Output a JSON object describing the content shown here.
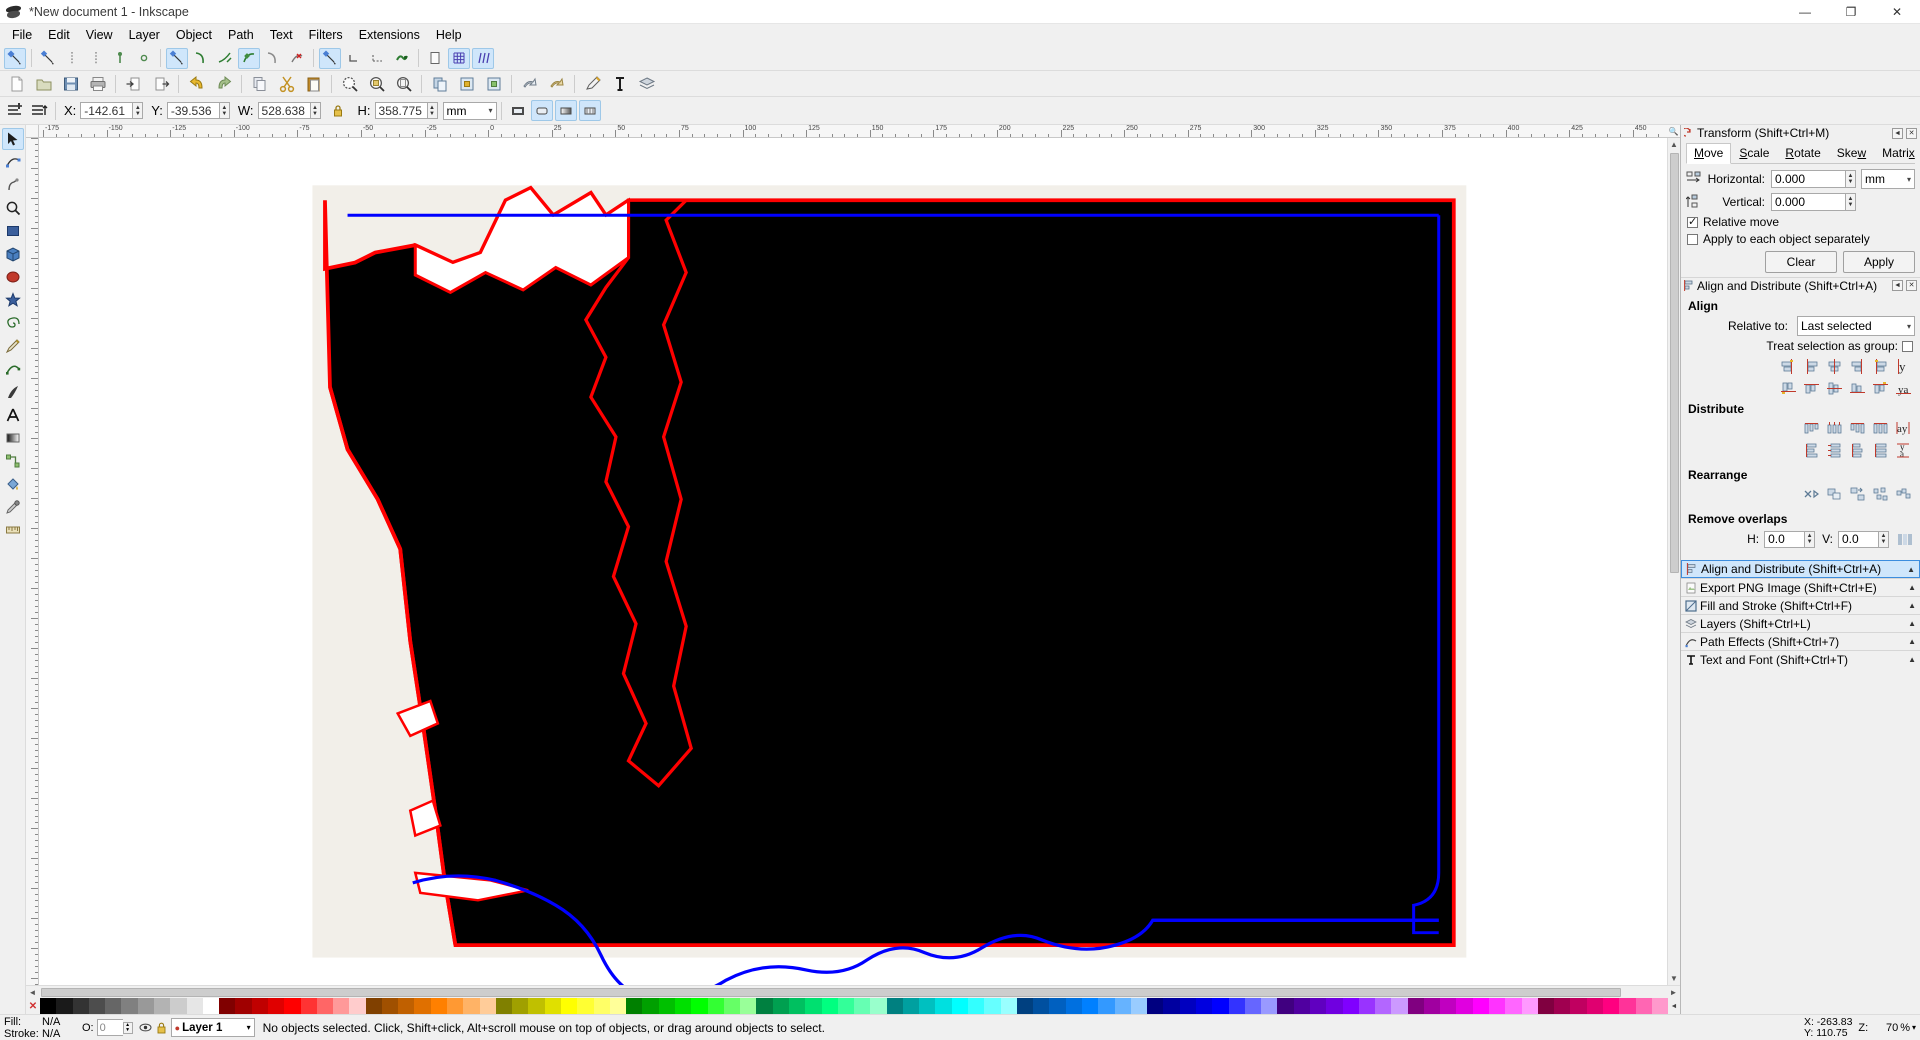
{
  "window": {
    "title": "*New document 1 - Inkscape",
    "app_icon": "inkscape-logo-icon",
    "buttons": [
      {
        "name": "minimize-button",
        "glyph": "—"
      },
      {
        "name": "maximize-button",
        "glyph": "❐"
      },
      {
        "name": "close-button",
        "glyph": "✕"
      }
    ]
  },
  "menubar": {
    "items": [
      {
        "label": "File"
      },
      {
        "label": "Edit"
      },
      {
        "label": "View"
      },
      {
        "label": "Layer"
      },
      {
        "label": "Object"
      },
      {
        "label": "Path"
      },
      {
        "label": "Text"
      },
      {
        "label": "Filters"
      },
      {
        "label": "Extensions"
      },
      {
        "label": "Help"
      }
    ]
  },
  "snap_toolbar": {
    "buttons": [
      {
        "name": "snap-enable-button",
        "icon": "snap-node-cusp-icon",
        "active": true
      },
      {
        "name": "snap-bounding-box-button",
        "icon": "snap-bbox-icon",
        "active": false
      },
      {
        "name": "snap-bbox-edge-button",
        "icon": "snap-bbox-edge-icon",
        "active": false
      },
      {
        "name": "snap-bbox-corner-button",
        "icon": "snap-bbox-corner-icon",
        "active": false
      },
      {
        "name": "snap-bbox-edge-midpoint-button",
        "icon": "snap-bbox-edge-mid-icon",
        "active": false
      },
      {
        "name": "snap-bbox-center-button",
        "icon": "snap-bbox-center-icon",
        "active": false
      },
      {
        "name": "snap-nodes-button",
        "icon": "snap-nodes-icon",
        "active": true
      },
      {
        "name": "snap-path-button",
        "icon": "snap-path-icon",
        "active": false
      },
      {
        "name": "snap-path-intersection-button",
        "icon": "snap-path-intersection-icon",
        "active": false
      },
      {
        "name": "snap-to-cusp-node-button",
        "icon": "snap-cusp-node-icon",
        "active": true
      },
      {
        "name": "snap-smooth-node-button",
        "icon": "snap-smooth-node-icon",
        "active": false
      },
      {
        "name": "snap-midpoint-button",
        "icon": "snap-midpoint-icon",
        "active": false
      },
      {
        "name": "snap-others-button",
        "icon": "snap-others-icon",
        "active": true
      },
      {
        "name": "snap-object-center-button",
        "icon": "snap-object-center-icon",
        "active": false
      },
      {
        "name": "snap-rotation-center-button",
        "icon": "snap-rotation-center-icon",
        "active": false
      },
      {
        "name": "snap-text-baseline-button",
        "icon": "snap-text-baseline-icon",
        "active": false
      },
      {
        "name": "snap-page-border-button",
        "icon": "snap-page-border-icon",
        "active": false
      },
      {
        "name": "snap-grid-button",
        "icon": "snap-grid-icon",
        "active": true
      },
      {
        "name": "snap-guide-button",
        "icon": "snap-guide-icon",
        "active": true
      }
    ]
  },
  "command_toolbar": {
    "buttons": [
      {
        "name": "new-document-button",
        "icon": "new-document-icon"
      },
      {
        "name": "open-document-button",
        "icon": "open-folder-icon"
      },
      {
        "name": "save-document-button",
        "icon": "floppy-save-icon"
      },
      {
        "name": "print-document-button",
        "icon": "printer-icon"
      },
      {
        "name": "import-button",
        "icon": "import-arrow-icon"
      },
      {
        "name": "export-button",
        "icon": "export-arrow-icon"
      },
      {
        "name": "undo-button",
        "icon": "undo-arrow-icon"
      },
      {
        "name": "redo-button",
        "icon": "redo-arrow-icon"
      },
      {
        "name": "copy-button",
        "icon": "copy-icon"
      },
      {
        "name": "cut-button",
        "icon": "scissors-icon"
      },
      {
        "name": "paste-button",
        "icon": "clipboard-paste-icon"
      },
      {
        "name": "zoom-selection-button",
        "icon": "zoom-selection-icon"
      },
      {
        "name": "zoom-drawing-button",
        "icon": "zoom-drawing-icon"
      },
      {
        "name": "zoom-page-button",
        "icon": "zoom-page-icon"
      },
      {
        "name": "duplicate-button",
        "icon": "duplicate-icon"
      },
      {
        "name": "group-button",
        "icon": "group-lock-icon"
      },
      {
        "name": "ungroup-button",
        "icon": "ungroup-icon"
      },
      {
        "name": "raise-to-top-button",
        "icon": "raise-object-icon"
      },
      {
        "name": "lower-to-bottom-button",
        "icon": "lower-object-icon"
      },
      {
        "name": "xml-editor-button",
        "icon": "pencil-xml-icon"
      },
      {
        "name": "text-and-font-button",
        "icon": "text-tool-icon"
      },
      {
        "name": "layers-dialog-button",
        "icon": "layers-stack-icon"
      },
      {
        "name": "fill-stroke-button",
        "icon": "fill-stroke-icon"
      },
      {
        "name": "preferences-button",
        "icon": "gear-icon"
      }
    ]
  },
  "tool_options": {
    "buttons": [
      {
        "name": "select-all-button",
        "icon": "select-all-icon"
      },
      {
        "name": "select-all-layers-button",
        "icon": "select-all-layers-icon"
      },
      {
        "name": "deselect-button",
        "icon": "deselect-icon"
      },
      {
        "name": "rotate-ccw-button",
        "icon": "rotate-ccw-icon"
      },
      {
        "name": "rotate-cw-button",
        "icon": "rotate-cw-icon"
      },
      {
        "name": "flip-horizontal-button",
        "icon": "flip-horizontal-icon"
      },
      {
        "name": "flip-vertical-button",
        "icon": "flip-vertical-icon"
      },
      {
        "name": "raise-top-button",
        "icon": "raise-top-icon"
      },
      {
        "name": "raise-one-button",
        "icon": "raise-one-icon"
      },
      {
        "name": "lower-one-button",
        "icon": "lower-one-icon"
      },
      {
        "name": "lower-bottom-button",
        "icon": "lower-bottom-icon"
      }
    ],
    "fields": [
      {
        "name": "x-field",
        "label": "X:",
        "value": "-142.61"
      },
      {
        "name": "y-field",
        "label": "Y:",
        "value": "-39.536"
      },
      {
        "name": "w-field",
        "label": "W:",
        "value": "528.638"
      },
      {
        "name": "h-field",
        "label": "H:",
        "value": "358.775"
      }
    ],
    "lock_icon": "lock-ratio-icon",
    "units": "mm",
    "affect_buttons": [
      {
        "name": "affect-stroke-width-button",
        "icon": "scale-stroke-icon",
        "active": false
      },
      {
        "name": "affect-rounded-corners-button",
        "icon": "scale-corners-icon",
        "active": true
      },
      {
        "name": "affect-gradients-button",
        "icon": "scale-gradients-icon",
        "active": true
      },
      {
        "name": "affect-patterns-button",
        "icon": "scale-patterns-icon",
        "active": true
      }
    ]
  },
  "toolbox": {
    "tools": [
      {
        "name": "tool-selector",
        "icon": "arrow-pointer-icon",
        "active": true
      },
      {
        "name": "tool-node-editor",
        "icon": "node-editor-icon",
        "active": false
      },
      {
        "name": "tool-tweak",
        "icon": "tweak-icon",
        "active": false
      },
      {
        "name": "tool-zoom",
        "icon": "magnifier-icon",
        "active": false
      },
      {
        "name": "tool-rectangle",
        "icon": "rectangle-icon",
        "active": false
      },
      {
        "name": "tool-3dbox",
        "icon": "cube-3d-icon",
        "active": false
      },
      {
        "name": "tool-ellipse",
        "icon": "ellipse-icon",
        "active": false
      },
      {
        "name": "tool-star",
        "icon": "star-icon",
        "active": false
      },
      {
        "name": "tool-spiral",
        "icon": "spiral-icon",
        "active": false
      },
      {
        "name": "tool-pencil",
        "icon": "pencil-icon",
        "active": false
      },
      {
        "name": "tool-bezier",
        "icon": "bezier-pen-icon",
        "active": false
      },
      {
        "name": "tool-calligraphy",
        "icon": "calligraphy-icon",
        "active": false
      },
      {
        "name": "tool-text",
        "icon": "text-a-icon",
        "active": false
      },
      {
        "name": "tool-gradient",
        "icon": "gradient-icon",
        "active": false
      },
      {
        "name": "tool-connector",
        "icon": "connector-icon",
        "active": false
      },
      {
        "name": "tool-paint-bucket",
        "icon": "paint-bucket-icon",
        "active": false
      },
      {
        "name": "tool-dropper",
        "icon": "eyedropper-icon",
        "active": false
      },
      {
        "name": "tool-measure",
        "icon": "measure-ruler-icon",
        "active": false
      }
    ]
  },
  "canvas": {
    "ruler_unit_icon": "zoom-unit-icon",
    "h_ruler_labels": [
      "-175",
      "-150",
      "-125",
      "-100",
      "-75",
      "-50",
      "-25",
      "0",
      "25",
      "50",
      "75",
      "100",
      "125",
      "150",
      "175",
      "200",
      "225",
      "250",
      "275",
      "300",
      "325",
      "350",
      "375",
      "400",
      "425",
      "450"
    ],
    "document": {
      "page_background": "#f2efe9",
      "artwork_fill": "#000000",
      "artwork_stroke": "#ff0000",
      "overlay_path_stroke": "#0000ff",
      "description": "Map outline of Washington State filled black with red coastline stroke and a blue boundary path"
    }
  },
  "transform_panel": {
    "title": "Transform (Shift+Ctrl+M)",
    "title_icon": "transform-dialog-icon",
    "float_button": "float-dialog-icon",
    "close_button": "close-dialog-icon",
    "tabs": [
      {
        "name": "tab-move",
        "label": "Move",
        "mnemonic": "M",
        "active": true
      },
      {
        "name": "tab-scale",
        "label": "Scale",
        "mnemonic": "S",
        "active": false
      },
      {
        "name": "tab-rotate",
        "label": "Rotate",
        "mnemonic": "R",
        "active": false
      },
      {
        "name": "tab-skew",
        "label": "Skew",
        "mnemonic": "w",
        "active": false
      },
      {
        "name": "tab-matrix",
        "label": "Matrix",
        "mnemonic": "x",
        "active": false
      }
    ],
    "horizontal": {
      "label": "Horizontal:",
      "value": "0.000",
      "icon": "move-horizontal-icon"
    },
    "vertical": {
      "label": "Vertical:",
      "value": "0.000",
      "icon": "move-vertical-icon"
    },
    "unit": "mm",
    "relative_move": {
      "label": "Relative move",
      "checked": true
    },
    "apply_each": {
      "label": "Apply to each object separately",
      "checked": false
    },
    "clear_button": "Clear",
    "apply_button": "Apply"
  },
  "align_panel": {
    "title": "Align and Distribute (Shift+Ctrl+A)",
    "title_icon": "align-dialog-icon",
    "float_button": "float-dialog-icon",
    "close_button": "close-dialog-icon",
    "align": {
      "heading": "Align",
      "relative_to_label": "Relative to:",
      "relative_to_value": "Last selected",
      "treat_as_group_label": "Treat selection as group:",
      "treat_as_group_checked": false,
      "row1": [
        {
          "name": "align-right-edge-to-left-anchor-button",
          "icon": "align-right-to-anchor-icon"
        },
        {
          "name": "align-left-edges-button",
          "icon": "align-left-edges-icon"
        },
        {
          "name": "align-horizontal-centers-button",
          "icon": "align-h-centers-icon"
        },
        {
          "name": "align-right-edges-button",
          "icon": "align-right-edges-icon"
        },
        {
          "name": "align-left-edge-to-right-anchor-button",
          "icon": "align-left-to-anchor-icon"
        },
        {
          "name": "align-text-baseline-vertical-button",
          "icon": "align-text-baseline-v-icon"
        }
      ],
      "row2": [
        {
          "name": "align-bottom-edge-to-top-anchor-button",
          "icon": "align-bottom-to-anchor-icon"
        },
        {
          "name": "align-top-edges-button",
          "icon": "align-top-edges-icon"
        },
        {
          "name": "align-vertical-centers-button",
          "icon": "align-v-centers-icon"
        },
        {
          "name": "align-bottom-edges-button",
          "icon": "align-bottom-edges-icon"
        },
        {
          "name": "align-top-edge-to-bottom-anchor-button",
          "icon": "align-top-to-anchor-icon"
        },
        {
          "name": "align-text-baseline-horizontal-button",
          "icon": "align-text-baseline-h-icon"
        }
      ]
    },
    "distribute": {
      "heading": "Distribute",
      "row1": [
        {
          "name": "distribute-left-edges-button",
          "icon": "distribute-left-edges-icon"
        },
        {
          "name": "distribute-h-centers-button",
          "icon": "distribute-h-centers-icon"
        },
        {
          "name": "distribute-right-edges-button",
          "icon": "distribute-right-edges-icon"
        },
        {
          "name": "distribute-h-gaps-button",
          "icon": "distribute-h-gaps-icon"
        },
        {
          "name": "distribute-text-anchors-h-button",
          "icon": "distribute-text-anchors-h-icon"
        }
      ],
      "row2": [
        {
          "name": "distribute-top-edges-button",
          "icon": "distribute-top-edges-icon"
        },
        {
          "name": "distribute-v-centers-button",
          "icon": "distribute-v-centers-icon"
        },
        {
          "name": "distribute-bottom-edges-button",
          "icon": "distribute-bottom-edges-icon"
        },
        {
          "name": "distribute-v-gaps-button",
          "icon": "distribute-v-gaps-icon"
        },
        {
          "name": "distribute-text-anchors-v-button",
          "icon": "distribute-text-anchors-v-icon"
        }
      ]
    },
    "rearrange": {
      "heading": "Rearrange",
      "buttons": [
        {
          "name": "exchange-selected-button",
          "icon": "exchange-objects-icon"
        },
        {
          "name": "exchange-zorder-button",
          "icon": "exchange-zorder-icon"
        },
        {
          "name": "exchange-clockwise-button",
          "icon": "exchange-clockwise-icon"
        },
        {
          "name": "randomize-positions-button",
          "icon": "randomize-positions-icon"
        },
        {
          "name": "unclump-objects-button",
          "icon": "unclump-objects-icon"
        }
      ]
    },
    "remove_overlaps": {
      "heading": "Remove overlaps",
      "h_label": "H:",
      "h_value": "0.0",
      "v_label": "V:",
      "v_value": "0.0",
      "action_icon": "remove-overlaps-icon"
    }
  },
  "dock_strips": [
    {
      "name": "strip-align-and-distribute",
      "label": "Align and Distribute (Shift+Ctrl+A)",
      "icon": "align-dialog-icon",
      "selected": true
    },
    {
      "name": "strip-export-png-image",
      "label": "Export PNG Image (Shift+Ctrl+E)",
      "icon": "export-png-icon",
      "selected": false
    },
    {
      "name": "strip-fill-and-stroke",
      "label": "Fill and Stroke (Shift+Ctrl+F)",
      "icon": "fill-stroke-icon",
      "selected": false
    },
    {
      "name": "strip-layers",
      "label": "Layers (Shift+Ctrl+L)",
      "icon": "layers-stack-icon",
      "selected": false
    },
    {
      "name": "strip-path-effects",
      "label": "Path Effects  (Shift+Ctrl+7)",
      "icon": "path-effects-icon",
      "selected": false
    },
    {
      "name": "strip-text-and-font",
      "label": "Text and Font (Shift+Ctrl+T)",
      "icon": "text-tool-icon",
      "selected": false
    }
  ],
  "palette": {
    "remove_color_glyph": "✕",
    "menu_glyph": "◄",
    "colors": [
      "#000000",
      "#1a1a1a",
      "#333333",
      "#4d4d4d",
      "#666666",
      "#808080",
      "#999999",
      "#b3b3b3",
      "#cccccc",
      "#e6e6e6",
      "#ffffff",
      "#800000",
      "#a00000",
      "#c00000",
      "#e00000",
      "#ff0000",
      "#ff3333",
      "#ff6666",
      "#ff9999",
      "#ffcccc",
      "#804000",
      "#a05000",
      "#c06000",
      "#e07000",
      "#ff8000",
      "#ff9933",
      "#ffb366",
      "#ffcc99",
      "#808000",
      "#a0a000",
      "#c0c000",
      "#e0e000",
      "#ffff00",
      "#ffff33",
      "#ffff66",
      "#ffff99",
      "#008000",
      "#00a000",
      "#00c000",
      "#00e000",
      "#00ff00",
      "#33ff33",
      "#66ff66",
      "#99ff99",
      "#008040",
      "#00a050",
      "#00c060",
      "#00e070",
      "#00ff80",
      "#33ff99",
      "#66ffb3",
      "#99ffcc",
      "#008080",
      "#00a0a0",
      "#00c0c0",
      "#00e0e0",
      "#00ffff",
      "#33ffff",
      "#66ffff",
      "#99ffff",
      "#004080",
      "#0050a0",
      "#0060c0",
      "#0070e0",
      "#0080ff",
      "#3399ff",
      "#66b3ff",
      "#99ccff",
      "#000080",
      "#0000a0",
      "#0000c0",
      "#0000e0",
      "#0000ff",
      "#3333ff",
      "#6666ff",
      "#9999ff",
      "#400080",
      "#5000a0",
      "#6000c0",
      "#7000e0",
      "#8000ff",
      "#9933ff",
      "#b366ff",
      "#cc99ff",
      "#800080",
      "#a000a0",
      "#c000c0",
      "#e000e0",
      "#ff00ff",
      "#ff33ff",
      "#ff66ff",
      "#ff99ff",
      "#800040",
      "#a00050",
      "#c00060",
      "#e00070",
      "#ff0080",
      "#ff3399",
      "#ff66b3",
      "#ff99cc"
    ]
  },
  "statusbar": {
    "fill_label": "Fill:",
    "fill_value": "N/A",
    "stroke_label": "Stroke:",
    "stroke_value": "N/A",
    "opacity_label": "O:",
    "opacity_value": "0",
    "eye_icon": "visibility-eye-icon",
    "lock_icon": "layer-lock-icon",
    "layer_name": "Layer 1",
    "message": "No objects selected. Click, Shift+click, Alt+scroll mouse on top of objects, or drag around objects to select.",
    "cursor_x_label": "X:",
    "cursor_x": "-263.83",
    "cursor_y_label": "Y:",
    "cursor_y": "110.75",
    "zoom_label": "Z:",
    "zoom_value": "70",
    "zoom_unit": "%"
  }
}
